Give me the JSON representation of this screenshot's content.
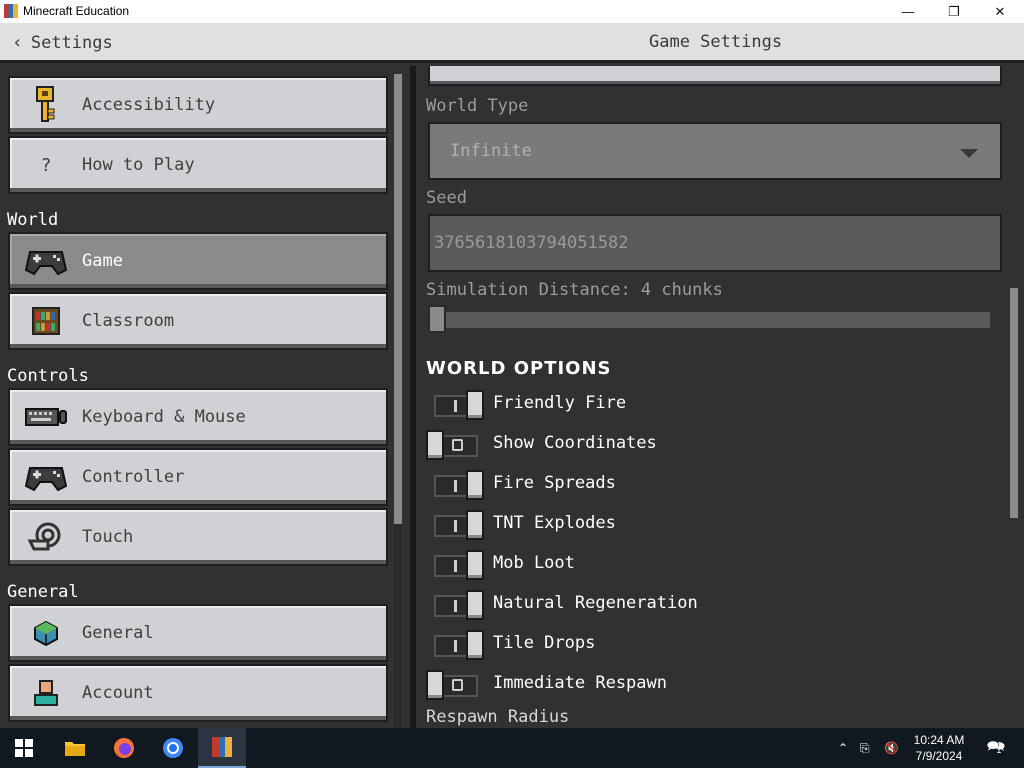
{
  "window": {
    "title": "Minecraft Education"
  },
  "header": {
    "back_label": "Settings",
    "title": "Game Settings"
  },
  "sidebar": {
    "sections": {
      "world": "World",
      "controls": "Controls",
      "general": "General"
    },
    "items": [
      {
        "label": "Accessibility",
        "icon": "key-icon"
      },
      {
        "label": "How to Play",
        "icon": "question-icon",
        "icon_text": "?"
      },
      {
        "label": "Game",
        "icon": "gamepad-icon",
        "selected": true
      },
      {
        "label": "Classroom",
        "icon": "bookshelf-icon"
      },
      {
        "label": "Keyboard & Mouse",
        "icon": "keyboard-icon"
      },
      {
        "label": "Controller",
        "icon": "controller-icon"
      },
      {
        "label": "Touch",
        "icon": "touch-icon"
      },
      {
        "label": "General",
        "icon": "globe-cube-icon"
      },
      {
        "label": "Account",
        "icon": "account-icon"
      }
    ]
  },
  "game_settings": {
    "world_type_label": "World Type",
    "world_type_value": "Infinite",
    "seed_label": "Seed",
    "seed_value": "3765618103794051582",
    "simulation_distance_label": "Simulation Distance: 4 chunks",
    "simulation_distance_fraction": 0.0,
    "world_options_heading": "WORLD OPTIONS",
    "options": [
      {
        "label": "Friendly Fire",
        "on": true
      },
      {
        "label": "Show Coordinates",
        "on": false
      },
      {
        "label": "Fire Spreads",
        "on": true
      },
      {
        "label": "TNT Explodes",
        "on": true
      },
      {
        "label": "Mob Loot",
        "on": true
      },
      {
        "label": "Natural Regeneration",
        "on": true
      },
      {
        "label": "Tile Drops",
        "on": true
      },
      {
        "label": "Immediate Respawn",
        "on": false
      }
    ],
    "respawn_radius_label": "Respawn Radius"
  },
  "taskbar": {
    "time": "10:24 AM",
    "date": "7/9/2024",
    "notification_count": "1"
  },
  "colors": {
    "panel_bg": "#313131",
    "button_face": "#d0d1d4",
    "button_selected": "#8b8b8d",
    "header_bg": "#e0e0e0",
    "taskbar_bg": "#101820"
  }
}
